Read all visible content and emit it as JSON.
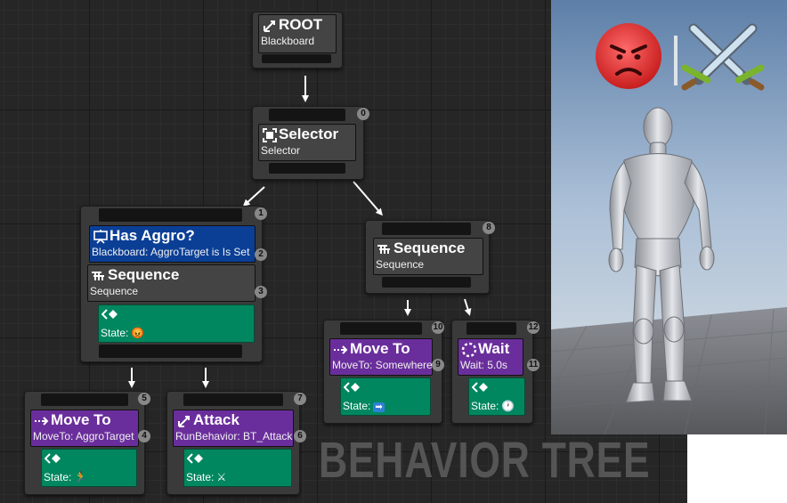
{
  "graph": {
    "watermark": "BEHAVIOR TREE",
    "root": {
      "title": "ROOT",
      "subtitle": "Blackboard"
    },
    "selector": {
      "title": "Selector",
      "subtitle": "Selector",
      "index": "0"
    },
    "left_sequence": {
      "index": "1",
      "decorator": {
        "title": "Has Aggro?",
        "subtitle": "Blackboard: AggroTarget is Is Set",
        "index": "2"
      },
      "title": "Sequence",
      "subtitle": "Sequence",
      "index_seq": "3",
      "service_state": "State:"
    },
    "move_to_aggro": {
      "index": "5",
      "title": "Move To",
      "subtitle": "MoveTo: AggroTarget",
      "index_task": "4",
      "service_state": "State:"
    },
    "attack": {
      "index": "7",
      "title": "Attack",
      "subtitle": "RunBehavior: BT_Attack",
      "index_task": "6",
      "service_state": "State:"
    },
    "right_sequence": {
      "title": "Sequence",
      "subtitle": "Sequence",
      "index": "8"
    },
    "move_to_somewhere": {
      "index": "10",
      "title": "Move To",
      "subtitle": "MoveTo: Somewhere",
      "index_task": "9",
      "service_state": "State:"
    },
    "wait": {
      "index": "12",
      "title": "Wait",
      "subtitle": "Wait: 5.0s",
      "index_task": "11",
      "service_state": "State:"
    }
  },
  "state_icons": {
    "left_sequence": "angry-face-icon",
    "move_to_aggro": "running-person-icon",
    "attack": "crossed-swords-icon",
    "move_to_somewhere": "right-arrow-icon",
    "wait": "clock-icon"
  },
  "viewport": {
    "status_icon": "angry-face-icon",
    "action_icon": "crossed-swords-icon"
  },
  "colors": {
    "graph_bg": "#262626",
    "task_purple": "#6a2e9c",
    "decorator_blue": "#0b3f96",
    "service_green": "#00875f",
    "composite_gray": "#444444",
    "angry_red": "#e23a3a"
  }
}
